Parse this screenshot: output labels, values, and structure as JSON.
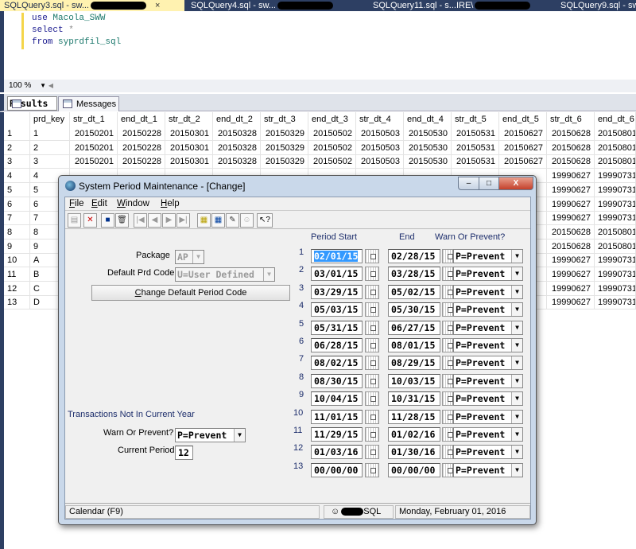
{
  "tabs": [
    {
      "label": "SQLQuery3.sql - sw...",
      "active": true,
      "close": "×"
    },
    {
      "label": "SQLQuery4.sql - sw...",
      "active": false
    },
    {
      "label": "SQLQuery11.sql - s...IRE\\",
      "active": false
    },
    {
      "label": "SQLQuery9.sql - sw",
      "active": false
    }
  ],
  "editor": {
    "lines": [
      {
        "kw": "use ",
        "rest": "Macola_SWW"
      },
      {
        "kw": "select ",
        "rest": "*"
      },
      {
        "kw": "from ",
        "rest": "syprdfil_sql"
      }
    ]
  },
  "zoom": "100 %",
  "result_tabs": [
    "Results",
    "Messages"
  ],
  "grid": {
    "columns": [
      "",
      "prd_key",
      "str_dt_1",
      "end_dt_1",
      "str_dt_2",
      "end_dt_2",
      "str_dt_3",
      "end_dt_3",
      "str_dt_4",
      "end_dt_4",
      "str_dt_5",
      "end_dt_5",
      "str_dt_6",
      "end_dt_6"
    ],
    "rows": [
      [
        "1",
        "1",
        "20150201",
        "20150228",
        "20150301",
        "20150328",
        "20150329",
        "20150502",
        "20150503",
        "20150530",
        "20150531",
        "20150627",
        "20150628",
        "20150801"
      ],
      [
        "2",
        "2",
        "20150201",
        "20150228",
        "20150301",
        "20150328",
        "20150329",
        "20150502",
        "20150503",
        "20150530",
        "20150531",
        "20150627",
        "20150628",
        "20150801"
      ],
      [
        "3",
        "3",
        "20150201",
        "20150228",
        "20150301",
        "20150328",
        "20150329",
        "20150502",
        "20150503",
        "20150530",
        "20150531",
        "20150627",
        "20150628",
        "20150801"
      ],
      [
        "4",
        "4",
        "",
        "",
        "",
        "",
        "",
        "",
        "",
        "",
        "",
        "",
        "19990627",
        "19990731"
      ],
      [
        "5",
        "5",
        "",
        "",
        "",
        "",
        "",
        "",
        "",
        "",
        "",
        "",
        "19990627",
        "19990731"
      ],
      [
        "6",
        "6",
        "",
        "",
        "",
        "",
        "",
        "",
        "",
        "",
        "",
        "",
        "19990627",
        "19990731"
      ],
      [
        "7",
        "7",
        "",
        "",
        "",
        "",
        "",
        "",
        "",
        "",
        "",
        "",
        "19990627",
        "19990731"
      ],
      [
        "8",
        "8",
        "",
        "",
        "",
        "",
        "",
        "",
        "",
        "",
        "",
        "",
        "20150628",
        "20150801"
      ],
      [
        "9",
        "9",
        "",
        "",
        "",
        "",
        "",
        "",
        "",
        "",
        "",
        "",
        "20150628",
        "20150801"
      ],
      [
        "10",
        "A",
        "",
        "",
        "",
        "",
        "",
        "",
        "",
        "",
        "",
        "",
        "19990627",
        "19990731"
      ],
      [
        "11",
        "B",
        "",
        "",
        "",
        "",
        "",
        "",
        "",
        "",
        "",
        "",
        "19990627",
        "19990731"
      ],
      [
        "12",
        "C",
        "",
        "",
        "",
        "",
        "",
        "",
        "",
        "",
        "",
        "",
        "19990627",
        "19990731"
      ],
      [
        "13",
        "D",
        "",
        "",
        "",
        "",
        "",
        "",
        "",
        "",
        "",
        "",
        "19990627",
        "19990731"
      ]
    ]
  },
  "dialog": {
    "title": "System Period Maintenance - [Change]",
    "window_buttons": {
      "minimize": "–",
      "maximize": "□",
      "close": "X"
    },
    "menu": [
      {
        "hot": "F",
        "rest": "ile"
      },
      {
        "hot": "E",
        "rest": "dit"
      },
      {
        "hot": "W",
        "rest": "indow"
      },
      {
        "hot": "H",
        "rest": "elp"
      }
    ],
    "toolbar_icons": [
      "new-icon",
      "delete-icon",
      "save-icon",
      "trash-icon",
      "first-icon",
      "prev-icon",
      "next-icon",
      "last-icon",
      "notes-icon",
      "calculator-icon",
      "chart-icon",
      "users-icon",
      "help-pointer-icon"
    ],
    "toolbar_glyphs": [
      "▤",
      "✕",
      "■",
      "🗑",
      "|◀",
      "◀",
      "▶",
      "▶|",
      "▦",
      "▦",
      "✎",
      "☺",
      "↖?"
    ],
    "package_label": "Package",
    "package_value": "AP",
    "default_prd_code_label": "Default Prd Code",
    "default_prd_code_value": "U=User Defined",
    "change_button": "Change Default Period Code",
    "trans_label": "Transactions Not In Current Year",
    "warn_label": "Warn Or Prevent?",
    "warn_value": "P=Prevent",
    "current_period_label": "Current Period",
    "current_period_value": "12",
    "headers": {
      "start": "Period Start",
      "end": "End",
      "warn": "Warn Or Prevent?"
    },
    "periods": [
      {
        "n": "1",
        "start": "02/01/15",
        "end": "02/28/15",
        "warn": "P=Prevent"
      },
      {
        "n": "2",
        "start": "03/01/15",
        "end": "03/28/15",
        "warn": "P=Prevent"
      },
      {
        "n": "3",
        "start": "03/29/15",
        "end": "05/02/15",
        "warn": "P=Prevent"
      },
      {
        "n": "4",
        "start": "05/03/15",
        "end": "05/30/15",
        "warn": "P=Prevent"
      },
      {
        "n": "5",
        "start": "05/31/15",
        "end": "06/27/15",
        "warn": "P=Prevent"
      },
      {
        "n": "6",
        "start": "06/28/15",
        "end": "08/01/15",
        "warn": "P=Prevent"
      },
      {
        "n": "7",
        "start": "08/02/15",
        "end": "08/29/15",
        "warn": "P=Prevent"
      },
      {
        "n": "8",
        "start": "08/30/15",
        "end": "10/03/15",
        "warn": "P=Prevent"
      },
      {
        "n": "9",
        "start": "10/04/15",
        "end": "10/31/15",
        "warn": "P=Prevent"
      },
      {
        "n": "10",
        "start": "11/01/15",
        "end": "11/28/15",
        "warn": "P=Prevent"
      },
      {
        "n": "11",
        "start": "11/29/15",
        "end": "01/02/16",
        "warn": "P=Prevent"
      },
      {
        "n": "12",
        "start": "01/03/16",
        "end": "01/30/16",
        "warn": "P=Prevent"
      },
      {
        "n": "13",
        "start": "00/00/00",
        "end": "00/00/00",
        "warn": "P=Prevent"
      }
    ],
    "status": {
      "hint": "Calendar (F9)",
      "user": "SQL",
      "date": "Monday, February 01, 2016"
    }
  }
}
